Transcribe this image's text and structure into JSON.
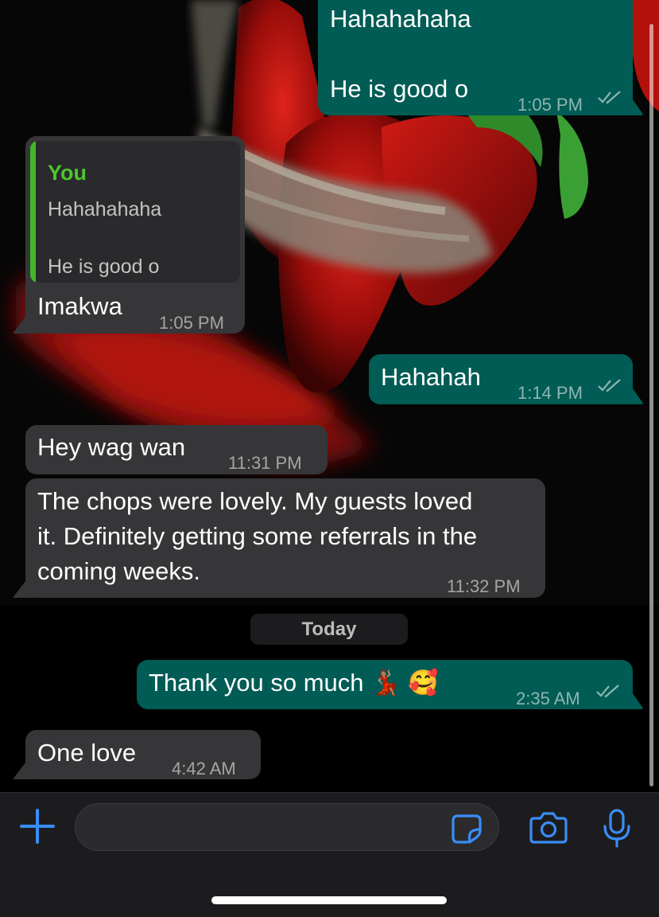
{
  "chat": {
    "messages": [
      {
        "text_line1": "Hahahahaha",
        "text_line2": "He is good o",
        "time": "1:05 PM"
      },
      {
        "quote_author": "You",
        "quote_line1": "Hahahahaha",
        "quote_line2": "He is good o",
        "text": "Imakwa",
        "time": "1:05 PM"
      },
      {
        "text": "Hahahah",
        "time": "1:14 PM"
      },
      {
        "text": "Hey wag wan",
        "time": "11:31 PM"
      },
      {
        "text_line1": "The chops were lovely. My guests loved",
        "text_line2": "it. Definitely getting some referrals in the",
        "text_line3": "coming weeks.",
        "time": "11:32 PM"
      },
      {
        "text": "Thank you so much 💃🏽 🥰",
        "time": "2:35 AM"
      },
      {
        "text": "One love",
        "time": "4:42 AM"
      }
    ],
    "date_separator": "Today"
  },
  "composer": {
    "placeholder": "",
    "icons": [
      "plus-icon",
      "sticker-icon",
      "camera-icon",
      "microphone-icon"
    ]
  },
  "colors": {
    "outgoing_bubble": "#005c54",
    "incoming_bubble": "#363638",
    "accent_blue": "#3a8df5",
    "quote_green": "#4cc62c"
  }
}
